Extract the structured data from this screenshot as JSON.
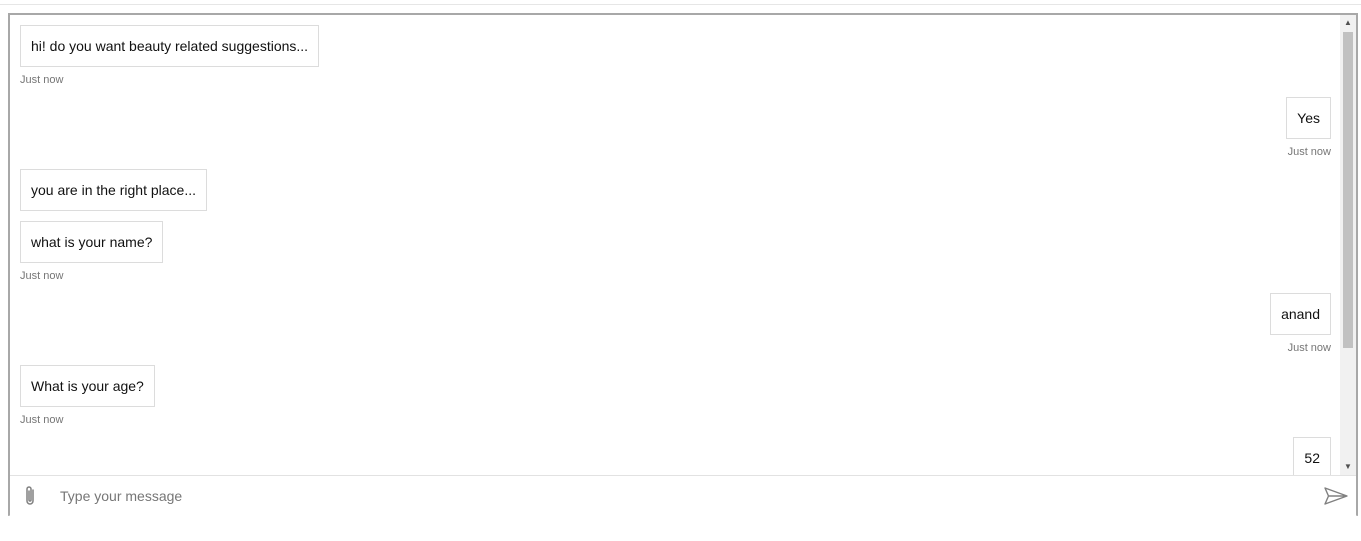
{
  "conversation": {
    "messages": [
      {
        "sender": "bot",
        "text": "hi! do you want beauty related suggestions..."
      },
      {
        "sender": "bot",
        "timestamp": "Just now"
      },
      {
        "sender": "user",
        "text": "Yes"
      },
      {
        "sender": "user",
        "timestamp": "Just now"
      },
      {
        "sender": "bot",
        "text": "you are in the right place..."
      },
      {
        "sender": "bot",
        "text": "what is your name?"
      },
      {
        "sender": "bot",
        "timestamp": "Just now"
      },
      {
        "sender": "user",
        "text": "anand"
      },
      {
        "sender": "user",
        "timestamp": "Just now"
      },
      {
        "sender": "bot",
        "text": "What is your age?"
      },
      {
        "sender": "bot",
        "timestamp": "Just now"
      },
      {
        "sender": "user",
        "text": "52"
      }
    ]
  },
  "composer": {
    "placeholder": "Type your message",
    "value": "",
    "attach_icon": "paperclip-icon",
    "send_icon": "send-icon"
  },
  "scrollbar": {
    "up_icon": "scroll-up-arrow-icon",
    "down_icon": "scroll-down-arrow-icon"
  },
  "colors": {
    "frame_border": "#a8a8a8",
    "bubble_border": "#dcdcdc",
    "timestamp_text": "#767676",
    "icon_gray": "#808080"
  }
}
